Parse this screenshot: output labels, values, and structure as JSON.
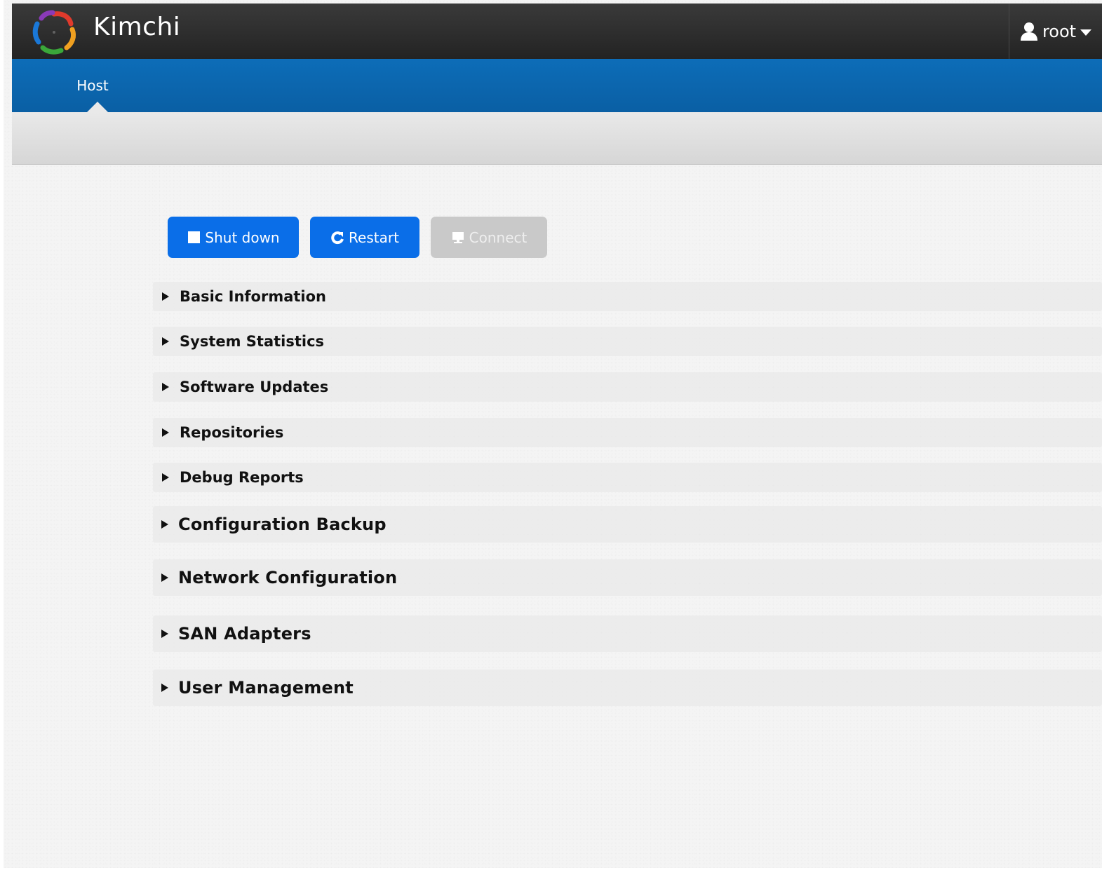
{
  "app": {
    "title": "Kimchi",
    "logo_icon": "kimchi-logo-icon"
  },
  "user_menu": {
    "username": "root",
    "user_icon": "user-icon",
    "caret_icon": "caret-down-icon"
  },
  "nav": {
    "tabs": [
      {
        "label": "Host",
        "active": true
      }
    ]
  },
  "actions": {
    "shutdown": {
      "label": "Shut down",
      "icon": "stop-square-icon",
      "enabled": true
    },
    "restart": {
      "label": "Restart",
      "icon": "restart-icon",
      "enabled": true
    },
    "connect": {
      "label": "Connect",
      "icon": "monitor-icon",
      "enabled": false
    }
  },
  "sections": [
    {
      "label": "Basic Information",
      "expanded": false
    },
    {
      "label": "System Statistics",
      "expanded": false
    },
    {
      "label": "Software Updates",
      "expanded": false
    },
    {
      "label": "Repositories",
      "expanded": false
    },
    {
      "label": "Debug Reports",
      "expanded": false
    },
    {
      "label": "Configuration Backup",
      "expanded": false
    },
    {
      "label": "Network Configuration",
      "expanded": false
    },
    {
      "label": "SAN Adapters",
      "expanded": false
    },
    {
      "label": "User Management",
      "expanded": false
    }
  ],
  "colors": {
    "topbar": "#2e2e2e",
    "navbar": "#0b66ae",
    "primary_button": "#0a6ee8",
    "disabled_button": "#c9c9c9",
    "page_background": "#f4f4f4"
  }
}
